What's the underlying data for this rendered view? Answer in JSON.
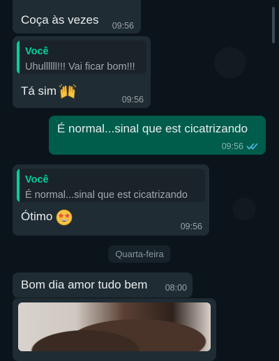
{
  "messages": [
    {
      "id": "m1",
      "direction": "incoming",
      "text": "Coça às vezes",
      "time": "09:56"
    },
    {
      "id": "m2",
      "direction": "incoming",
      "quote": {
        "author": "Você",
        "text": "Uhullllll!!! Vai ficar bom!!!"
      },
      "text": "Tá sim",
      "emoji": "raised-hands",
      "time": "09:56"
    },
    {
      "id": "m3",
      "direction": "outgoing",
      "text": "É normal...sinal que est cicatrizando",
      "time": "09:56",
      "status": "read"
    },
    {
      "id": "m4",
      "direction": "incoming",
      "quote": {
        "author": "Você",
        "text": "É normal...sinal que est cicatrizando"
      },
      "text": "Ótimo",
      "emoji": "star-struck",
      "time": "09:56"
    },
    {
      "id": "m5",
      "direction": "incoming",
      "text": "Bom dia amor tudo bem",
      "time": "08:00"
    }
  ],
  "date_separator": "Quarta-feira",
  "colors": {
    "background": "#0b141a",
    "incoming": "#202c33",
    "outgoing": "#005c4b",
    "quote_accent": "#06cf9c",
    "read_ticks": "#53bdeb"
  }
}
